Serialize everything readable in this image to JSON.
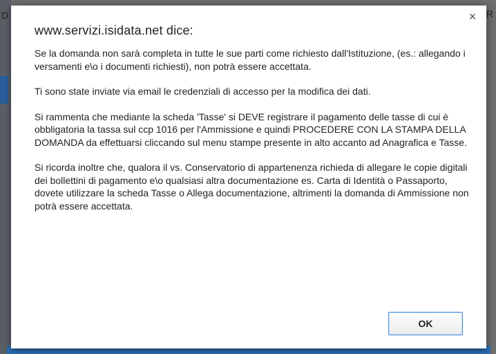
{
  "background": {
    "left_text": "D",
    "right_text": "R"
  },
  "dialog": {
    "title": "www.servizi.isidata.net dice:",
    "close_glyph": "×",
    "paragraphs": [
      "Se la domanda non sarà completa in tutte le sue parti come richiesto dall'Istituzione, (es.: allegando i versamenti e\\o i documenti richiesti), non potrà essere accettata.",
      "Ti sono state inviate via email le credenziali di accesso per la modifica dei dati.",
      "Si rammenta che mediante la scheda 'Tasse' si DEVE registrare il pagamento delle tasse di cui è obbligatoria la tassa sul ccp 1016 per l'Ammissione e quindi PROCEDERE CON LA STAMPA DELLA DOMANDA da effettuarsi cliccando sul menu stampe presente in alto accanto ad Anagrafica e Tasse.",
      "Si ricorda inoltre che, qualora il vs. Conservatorio di appartenenza richieda di allegare le copie digitali dei bollettini di pagamento e\\o qualsiasi altra documentazione es. Carta di Identità o Passaporto, dovete utilizzare la scheda Tasse o Allega documentazione, altrimenti la domanda di Ammissione non potrà essere accettata."
    ],
    "ok_label": "OK"
  },
  "colors": {
    "ok_border": "#4a90d9",
    "dialog_bg": "#ffffff",
    "overlay": "#6e6e6e"
  }
}
